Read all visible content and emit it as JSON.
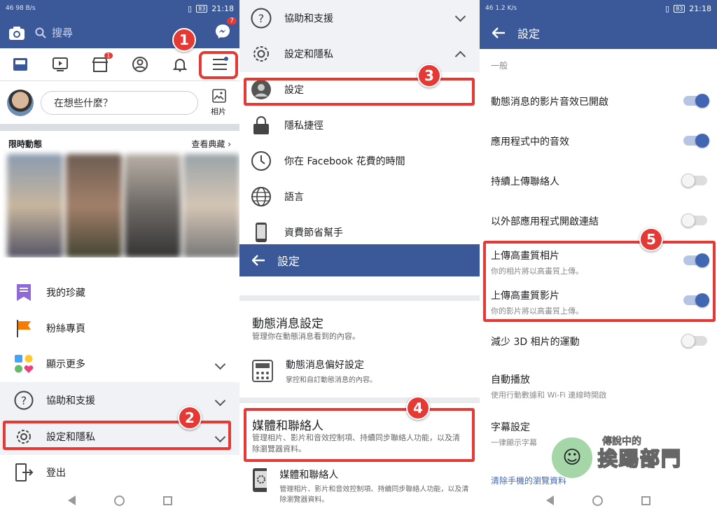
{
  "status": {
    "left_left": "46 98 B/s",
    "time": "21:18",
    "battery": "83",
    "left_right": "46 1.2 K/s"
  },
  "panel1": {
    "search_placeholder": "搜尋",
    "messenger_badge": "7",
    "market_badge": "1",
    "compose_placeholder": "在想些什麼？",
    "photo_label": "相片",
    "stories_title": "限時動態",
    "stories_link": "查看典藏",
    "menu": [
      {
        "label": "我的珍藏",
        "icon": "bookmark-icon"
      },
      {
        "label": "粉絲專頁",
        "icon": "flag-icon"
      },
      {
        "label": "顯示更多",
        "icon": "shapes-icon"
      },
      {
        "label": "協助和支援",
        "icon": "question-icon"
      },
      {
        "label": "設定和隱私",
        "icon": "gear-icon"
      },
      {
        "label": "登出",
        "icon": "logout-icon"
      }
    ],
    "callout1": "1",
    "callout2": "2"
  },
  "panel2": {
    "rows": [
      {
        "label": "協助和支援",
        "icon": "question-icon"
      },
      {
        "label": "設定和隱私",
        "icon": "gear-icon"
      },
      {
        "label": "設定",
        "icon": "profile-icon"
      },
      {
        "label": "隱私捷徑",
        "icon": "lock-icon"
      },
      {
        "label": "你在 Facebook 花費的時間",
        "icon": "clock-icon"
      },
      {
        "label": "語言",
        "icon": "globe-icon"
      },
      {
        "label": "資費節省幫手",
        "icon": "phone-icon"
      }
    ],
    "header_title": "設定",
    "newsfeed_title": "動態消息設定",
    "newsfeed_sub": "管理你在動態消息看到的內容。",
    "newsfeed_pref_title": "動態消息偏好設定",
    "newsfeed_pref_sub": "掌控和自訂動態消息的內容。",
    "media_title": "媒體和聯絡人",
    "media_sub": "管理相片、影片和音效控制項、持續同步聯絡人功能，以及清除瀏覽器資料。",
    "media_item_title": "媒體和聯絡人",
    "media_item_sub": "管理相片、影片和音效控制項、持續同步聯絡人功能，以及清除瀏覽器資料。",
    "callout3": "3",
    "callout4": "4"
  },
  "panel3": {
    "header_title": "設定",
    "section": "一般",
    "rows": [
      {
        "label": "動態消息的影片音效已開啟",
        "sub": "",
        "on": true
      },
      {
        "label": "應用程式中的音效",
        "sub": "",
        "on": true
      },
      {
        "label": "持續上傳聯絡人",
        "sub": "",
        "on": false
      },
      {
        "label": "以外部應用程式開啟連結",
        "sub": "",
        "on": false
      },
      {
        "label": "上傳高畫質相片",
        "sub": "你的相片將以高畫質上傳。",
        "on": true
      },
      {
        "label": "上傳高畫質影片",
        "sub": "你的影片將以高畫質上傳。",
        "on": true
      },
      {
        "label": "減少 3D 相片的運動",
        "sub": "",
        "on": false
      }
    ],
    "autoplay_title": "自動播放",
    "autoplay_sub": "使用行動數據和 Wi-Fi 連線時開啟",
    "caption_title": "字幕設定",
    "caption_sub": "一律顯示字幕",
    "clear_link": "清除手機的瀏覽資料",
    "callout5": "5",
    "watermark_small": "傳說中的",
    "watermark_big": "挨踢部門"
  }
}
